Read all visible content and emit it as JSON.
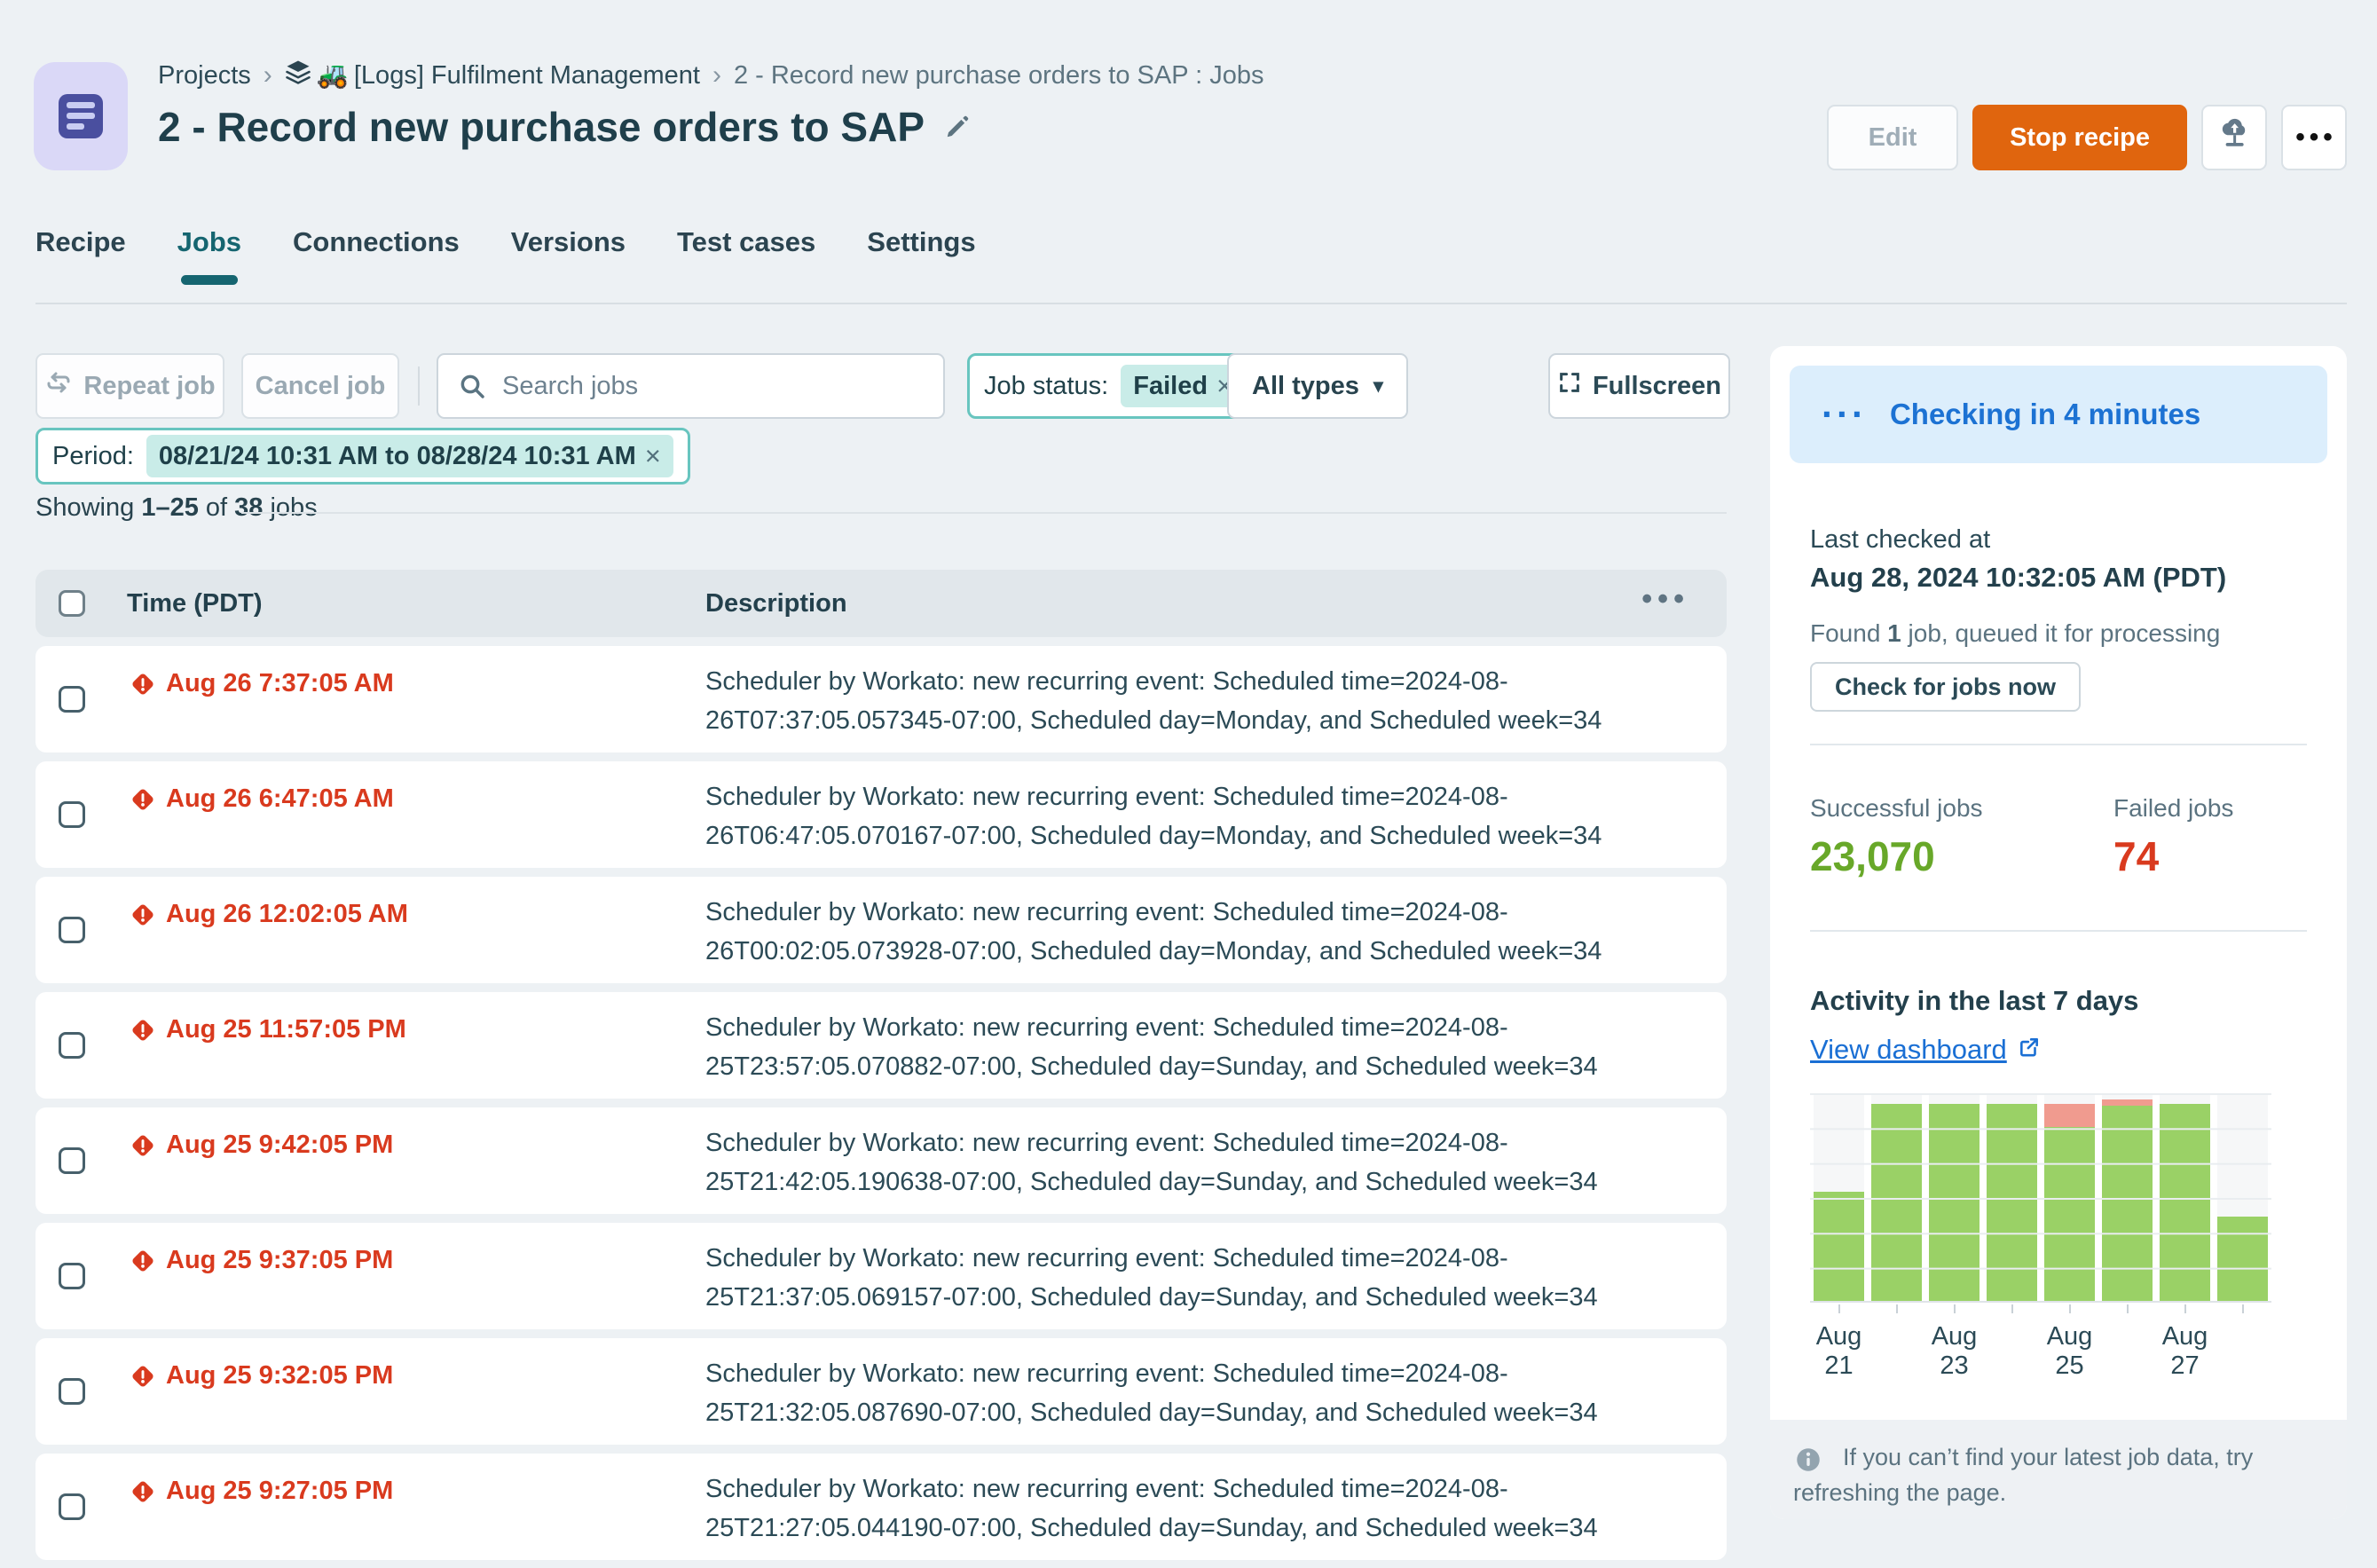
{
  "colors": {
    "accent_orange": "#e0650e",
    "teal": "#156570",
    "chip_teal": "#68c5bf",
    "red": "#d93a1e",
    "green_text": "#68a829",
    "bar_green": "#9ad166",
    "bar_red": "#f09b8f",
    "blue": "#1c72d3",
    "page_bg": "#edf1f4"
  },
  "icons": {
    "breadcrumb_sep": "›",
    "project_emoji": "🚜",
    "more": "•••",
    "header_menu": "•••",
    "checking_dots": "···",
    "dropdown_arrow": "▾",
    "close": "×"
  },
  "header": {
    "breadcrumb": {
      "items": [
        "Projects",
        "[Logs] Fulfilment Management",
        "2 - Record new purchase orders to SAP : Jobs"
      ]
    },
    "title": "2 - Record new purchase orders to SAP",
    "edit_label": "Edit",
    "stop_label": "Stop recipe"
  },
  "tabs": [
    {
      "label": "Recipe",
      "active": false
    },
    {
      "label": "Jobs",
      "active": true
    },
    {
      "label": "Connections",
      "active": false
    },
    {
      "label": "Versions",
      "active": false
    },
    {
      "label": "Test cases",
      "active": false
    },
    {
      "label": "Settings",
      "active": false
    }
  ],
  "toolbar": {
    "repeat_label": "Repeat job",
    "cancel_label": "Cancel job",
    "search_placeholder": "Search jobs",
    "status_label": "Job status:",
    "status_value": "Failed",
    "types_label": "All types",
    "fullscreen_label": "Fullscreen",
    "period_label": "Period:",
    "period_value": "08/21/24 10:31 AM to 08/28/24 10:31 AM"
  },
  "jobs": {
    "showing": {
      "pre": "Showing ",
      "range": "1–25",
      "mid": " of ",
      "total": "38",
      "post": " jobs"
    },
    "columns": {
      "time": "Time (PDT)",
      "desc": "Description"
    },
    "rows": [
      {
        "time": "Aug 26 7:37:05 AM",
        "desc1": "Scheduler by Workato: new recurring event: Scheduled time=2024-08-",
        "desc2": "26T07:37:05.057345-07:00, Scheduled day=Monday, and Scheduled week=34"
      },
      {
        "time": "Aug 26 6:47:05 AM",
        "desc1": "Scheduler by Workato: new recurring event: Scheduled time=2024-08-",
        "desc2": "26T06:47:05.070167-07:00, Scheduled day=Monday, and Scheduled week=34"
      },
      {
        "time": "Aug 26 12:02:05 AM",
        "desc1": "Scheduler by Workato: new recurring event: Scheduled time=2024-08-",
        "desc2": "26T00:02:05.073928-07:00, Scheduled day=Monday, and Scheduled week=34"
      },
      {
        "time": "Aug 25 11:57:05 PM",
        "desc1": "Scheduler by Workato: new recurring event: Scheduled time=2024-08-",
        "desc2": "25T23:57:05.070882-07:00, Scheduled day=Sunday, and Scheduled week=34"
      },
      {
        "time": "Aug 25 9:42:05 PM",
        "desc1": "Scheduler by Workato: new recurring event: Scheduled time=2024-08-",
        "desc2": "25T21:42:05.190638-07:00, Scheduled day=Sunday, and Scheduled week=34"
      },
      {
        "time": "Aug 25 9:37:05 PM",
        "desc1": "Scheduler by Workato: new recurring event: Scheduled time=2024-08-",
        "desc2": "25T21:37:05.069157-07:00, Scheduled day=Sunday, and Scheduled week=34"
      },
      {
        "time": "Aug 25 9:32:05 PM",
        "desc1": "Scheduler by Workato: new recurring event: Scheduled time=2024-08-",
        "desc2": "25T21:32:05.087690-07:00, Scheduled day=Sunday, and Scheduled week=34"
      },
      {
        "time": "Aug 25 9:27:05 PM",
        "desc1": "Scheduler by Workato: new recurring event: Scheduled time=2024-08-",
        "desc2": "25T21:27:05.044190-07:00, Scheduled day=Sunday, and Scheduled week=34"
      }
    ]
  },
  "sidebar": {
    "banner_text": "Checking in 4 minutes",
    "last_checked_label": "Last checked at",
    "last_checked_value": "Aug 28, 2024 10:32:05 AM (PDT)",
    "found": {
      "pre": "Found ",
      "count": "1",
      "post": " job, queued it for processing"
    },
    "check_button": "Check for jobs now",
    "stats": {
      "success_label": "Successful jobs",
      "success_value": "23,070",
      "failed_label": "Failed jobs",
      "failed_value": "74"
    },
    "activity_title": "Activity in the last 7 days",
    "dashboard_link": "View dashboard",
    "footer": "If you can’t find your latest job data, try refreshing the page."
  },
  "chart_data": {
    "type": "bar",
    "stacked": true,
    "title": "Activity in the last 7 days",
    "categories": [
      "Aug 21",
      "Aug 22",
      "Aug 23",
      "Aug 24",
      "Aug 25",
      "Aug 26",
      "Aug 27",
      "Aug 28"
    ],
    "x_tick_labels_shown": [
      "Aug 21",
      "Aug 23",
      "Aug 25",
      "Aug 27"
    ],
    "label_indices": [
      0,
      2,
      4,
      6
    ],
    "series": [
      {
        "name": "Successful jobs",
        "color": "#9ad166",
        "values": [
          53,
          95,
          95,
          95,
          84,
          94,
          95,
          41
        ]
      },
      {
        "name": "Failed jobs",
        "color": "#f09b8f",
        "values": [
          0,
          0,
          0,
          0,
          11,
          3,
          0,
          0
        ]
      }
    ],
    "ylabel": "",
    "xlabel": "",
    "ylim": [
      0,
      100
    ],
    "units": "relative bar height, % of plot (no y-axis labels shown)",
    "grid": "horizontal",
    "legend": false
  }
}
